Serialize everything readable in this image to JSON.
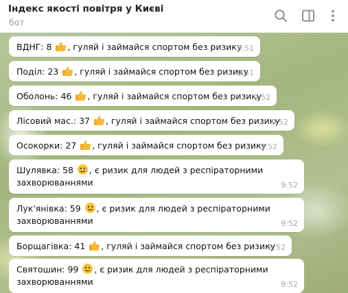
{
  "header": {
    "title": "Індекс якості повітря у Києві",
    "subtitle": "бот"
  },
  "messages": [
    {
      "prefix": "ВДНГ: 8 ",
      "emoji": "thumbs-up",
      "suffix": ", гуляй і займайся спортом без ризику",
      "time": "9:51"
    },
    {
      "prefix": "Поділ: 23 ",
      "emoji": "thumbs-up",
      "suffix": ", гуляй і займайся спортом без ризику",
      "time": "9:51"
    },
    {
      "prefix": "Оболонь: 46 ",
      "emoji": "thumbs-up",
      "suffix": ", гуляй і займайся спортом без ризику",
      "time": "9:52"
    },
    {
      "prefix": "Лісовий мас.: 37 ",
      "emoji": "thumbs-up",
      "suffix": ", гуляй і займайся спортом без ризику",
      "time": "9:52"
    },
    {
      "prefix": "Осокорки: 27 ",
      "emoji": "thumbs-up",
      "suffix": ", гуляй і займайся спортом без ризику",
      "time": "9:52"
    },
    {
      "prefix": "Шулявка: 58 ",
      "emoji": "neutral-face",
      "suffix": ", є ризик для людей з респіраторними",
      "line2": "захворюваннями",
      "time": "9:52"
    },
    {
      "prefix": "Лук'янівка: 59 ",
      "emoji": "neutral-face",
      "suffix": ", є ризик для людей з респіраторними",
      "line2": "захворюваннями",
      "time": "9:52"
    },
    {
      "prefix": "Борщагівка: 41 ",
      "emoji": "thumbs-up",
      "suffix": ", гуляй і займайся спортом без ризику",
      "time": "9:52"
    },
    {
      "prefix": "Святошин: 99 ",
      "emoji": "neutral-face",
      "suffix": ", є ризик для людей з респіраторними",
      "line2": "захворюваннями",
      "time": "9:52"
    }
  ],
  "colors": {
    "thumb": "#f5b93a",
    "face": "#f5c33b",
    "icon": "#8c9196"
  }
}
